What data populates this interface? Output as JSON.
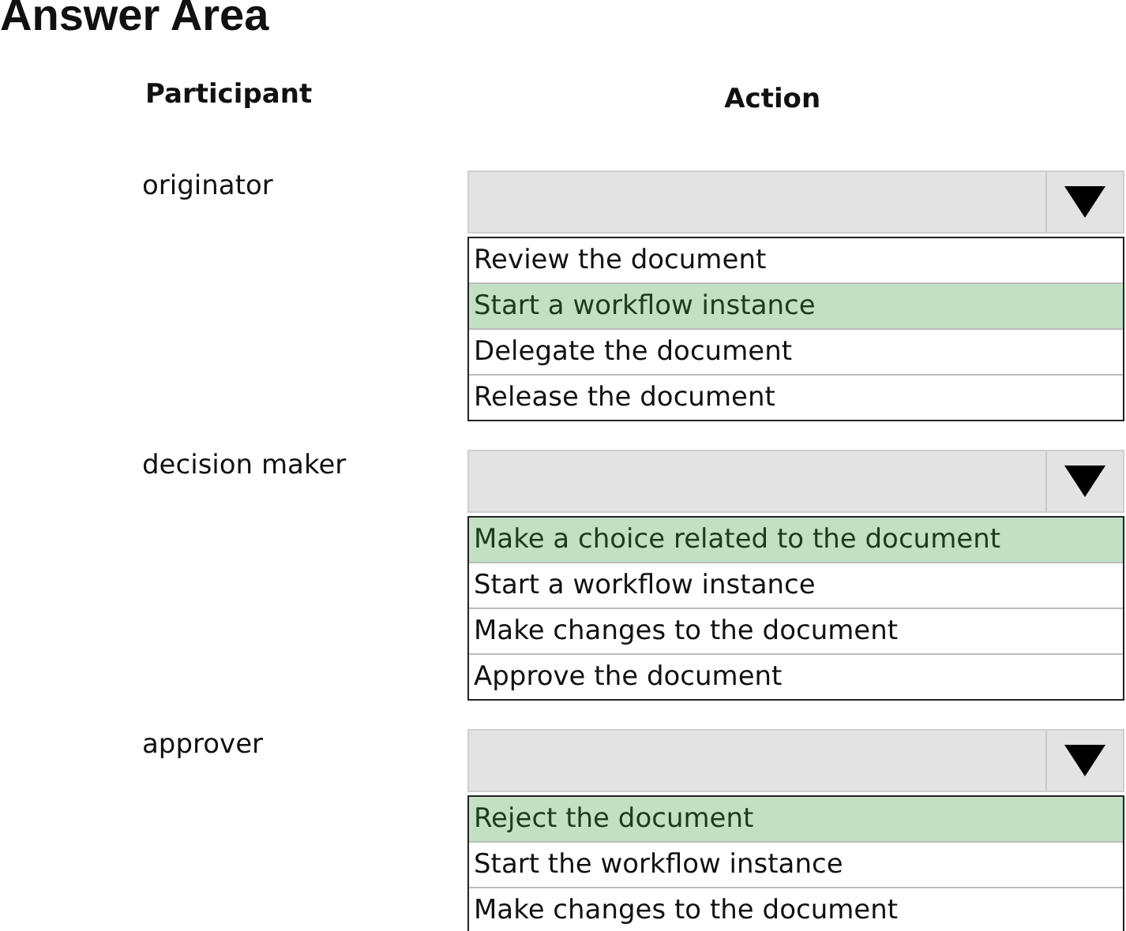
{
  "title": "Answer Area",
  "columns": {
    "participant": "Participant",
    "action": "Action"
  },
  "rows": [
    {
      "participant": "originator",
      "options": [
        {
          "label": "Review the document",
          "selected": false
        },
        {
          "label": "Start a workflow instance",
          "selected": true
        },
        {
          "label": "Delegate the document",
          "selected": false
        },
        {
          "label": "Release the document",
          "selected": false
        }
      ]
    },
    {
      "participant": "decision maker",
      "options": [
        {
          "label": "Make a choice related to the document",
          "selected": true
        },
        {
          "label": "Start a workflow instance",
          "selected": false
        },
        {
          "label": "Make changes to the document",
          "selected": false
        },
        {
          "label": "Approve the document",
          "selected": false
        }
      ]
    },
    {
      "participant": "approver",
      "options": [
        {
          "label": "Reject the document",
          "selected": true
        },
        {
          "label": "Start the workflow instance",
          "selected": false
        },
        {
          "label": "Make changes to the document",
          "selected": false
        }
      ]
    }
  ]
}
